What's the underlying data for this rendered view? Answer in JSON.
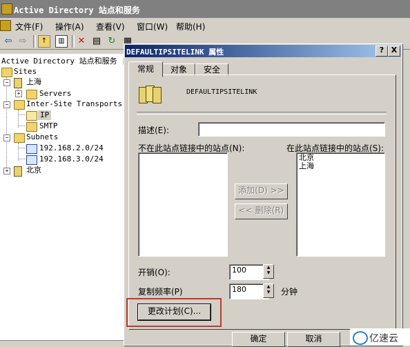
{
  "main_window": {
    "title": "Active Directory 站点和服务"
  },
  "menubar": {
    "items": [
      "文件(F)",
      "操作(A)",
      "查看(V)",
      "窗口(W)",
      "帮助(H)"
    ]
  },
  "toolbar": {
    "icons": [
      "back-icon",
      "forward-icon",
      "up-icon",
      "show-tree-icon",
      "delete-icon",
      "properties-icon",
      "refresh-icon",
      "export-icon",
      "help-icon"
    ]
  },
  "tree": {
    "root": "Active Directory 站点和服务 [s",
    "sites": "Sites",
    "shanghai": "上海",
    "servers": "Servers",
    "inter_site": "Inter-Site Transports",
    "ip": "IP",
    "smtp": "SMTP",
    "subnets": "Subnets",
    "subnet1": "192.168.2.0/24",
    "subnet2": "192.168.3.0/24",
    "beijing": "北京"
  },
  "dialog": {
    "title": "DEFAULTIPSITELINK 属性",
    "help_btn": "?",
    "close_btn": "X",
    "tabs": [
      "常规",
      "对象",
      "安全"
    ],
    "object_name": "DEFAULTIPSITELINK",
    "description_label": "描述(E):",
    "description_value": "",
    "not_in_link_label": "不在此站点链接中的站点(N):",
    "in_link_label": "在此站点链接中的站点(S):",
    "in_link_sites": [
      "北京",
      "上海"
    ],
    "not_in_link_sites": [],
    "add_btn": "添加(D) >>",
    "remove_btn": "<< 删除(R)",
    "cost_label": "开销(O):",
    "cost_value": "100",
    "replicate_label": "复制频率(P)",
    "replicate_value": "180",
    "replicate_unit": "分钟",
    "change_schedule_btn": "更改计划(C)...",
    "ok_btn": "确定",
    "cancel_btn": "取消"
  },
  "watermark": {
    "text": "亿速云"
  }
}
